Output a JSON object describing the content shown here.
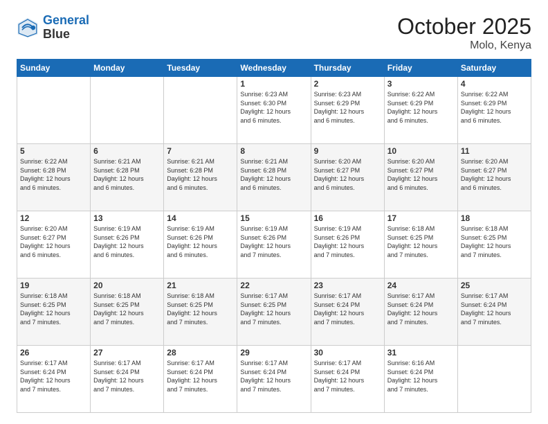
{
  "header": {
    "logo_line1": "General",
    "logo_line2": "Blue",
    "month": "October 2025",
    "location": "Molo, Kenya"
  },
  "weekdays": [
    "Sunday",
    "Monday",
    "Tuesday",
    "Wednesday",
    "Thursday",
    "Friday",
    "Saturday"
  ],
  "rows": [
    [
      {
        "day": "",
        "lines": []
      },
      {
        "day": "",
        "lines": []
      },
      {
        "day": "",
        "lines": []
      },
      {
        "day": "1",
        "lines": [
          "Sunrise: 6:23 AM",
          "Sunset: 6:30 PM",
          "Daylight: 12 hours",
          "and 6 minutes."
        ]
      },
      {
        "day": "2",
        "lines": [
          "Sunrise: 6:23 AM",
          "Sunset: 6:29 PM",
          "Daylight: 12 hours",
          "and 6 minutes."
        ]
      },
      {
        "day": "3",
        "lines": [
          "Sunrise: 6:22 AM",
          "Sunset: 6:29 PM",
          "Daylight: 12 hours",
          "and 6 minutes."
        ]
      },
      {
        "day": "4",
        "lines": [
          "Sunrise: 6:22 AM",
          "Sunset: 6:29 PM",
          "Daylight: 12 hours",
          "and 6 minutes."
        ]
      }
    ],
    [
      {
        "day": "5",
        "lines": [
          "Sunrise: 6:22 AM",
          "Sunset: 6:28 PM",
          "Daylight: 12 hours",
          "and 6 minutes."
        ]
      },
      {
        "day": "6",
        "lines": [
          "Sunrise: 6:21 AM",
          "Sunset: 6:28 PM",
          "Daylight: 12 hours",
          "and 6 minutes."
        ]
      },
      {
        "day": "7",
        "lines": [
          "Sunrise: 6:21 AM",
          "Sunset: 6:28 PM",
          "Daylight: 12 hours",
          "and 6 minutes."
        ]
      },
      {
        "day": "8",
        "lines": [
          "Sunrise: 6:21 AM",
          "Sunset: 6:28 PM",
          "Daylight: 12 hours",
          "and 6 minutes."
        ]
      },
      {
        "day": "9",
        "lines": [
          "Sunrise: 6:20 AM",
          "Sunset: 6:27 PM",
          "Daylight: 12 hours",
          "and 6 minutes."
        ]
      },
      {
        "day": "10",
        "lines": [
          "Sunrise: 6:20 AM",
          "Sunset: 6:27 PM",
          "Daylight: 12 hours",
          "and 6 minutes."
        ]
      },
      {
        "day": "11",
        "lines": [
          "Sunrise: 6:20 AM",
          "Sunset: 6:27 PM",
          "Daylight: 12 hours",
          "and 6 minutes."
        ]
      }
    ],
    [
      {
        "day": "12",
        "lines": [
          "Sunrise: 6:20 AM",
          "Sunset: 6:27 PM",
          "Daylight: 12 hours",
          "and 6 minutes."
        ]
      },
      {
        "day": "13",
        "lines": [
          "Sunrise: 6:19 AM",
          "Sunset: 6:26 PM",
          "Daylight: 12 hours",
          "and 6 minutes."
        ]
      },
      {
        "day": "14",
        "lines": [
          "Sunrise: 6:19 AM",
          "Sunset: 6:26 PM",
          "Daylight: 12 hours",
          "and 6 minutes."
        ]
      },
      {
        "day": "15",
        "lines": [
          "Sunrise: 6:19 AM",
          "Sunset: 6:26 PM",
          "Daylight: 12 hours",
          "and 7 minutes."
        ]
      },
      {
        "day": "16",
        "lines": [
          "Sunrise: 6:19 AM",
          "Sunset: 6:26 PM",
          "Daylight: 12 hours",
          "and 7 minutes."
        ]
      },
      {
        "day": "17",
        "lines": [
          "Sunrise: 6:18 AM",
          "Sunset: 6:25 PM",
          "Daylight: 12 hours",
          "and 7 minutes."
        ]
      },
      {
        "day": "18",
        "lines": [
          "Sunrise: 6:18 AM",
          "Sunset: 6:25 PM",
          "Daylight: 12 hours",
          "and 7 minutes."
        ]
      }
    ],
    [
      {
        "day": "19",
        "lines": [
          "Sunrise: 6:18 AM",
          "Sunset: 6:25 PM",
          "Daylight: 12 hours",
          "and 7 minutes."
        ]
      },
      {
        "day": "20",
        "lines": [
          "Sunrise: 6:18 AM",
          "Sunset: 6:25 PM",
          "Daylight: 12 hours",
          "and 7 minutes."
        ]
      },
      {
        "day": "21",
        "lines": [
          "Sunrise: 6:18 AM",
          "Sunset: 6:25 PM",
          "Daylight: 12 hours",
          "and 7 minutes."
        ]
      },
      {
        "day": "22",
        "lines": [
          "Sunrise: 6:17 AM",
          "Sunset: 6:25 PM",
          "Daylight: 12 hours",
          "and 7 minutes."
        ]
      },
      {
        "day": "23",
        "lines": [
          "Sunrise: 6:17 AM",
          "Sunset: 6:24 PM",
          "Daylight: 12 hours",
          "and 7 minutes."
        ]
      },
      {
        "day": "24",
        "lines": [
          "Sunrise: 6:17 AM",
          "Sunset: 6:24 PM",
          "Daylight: 12 hours",
          "and 7 minutes."
        ]
      },
      {
        "day": "25",
        "lines": [
          "Sunrise: 6:17 AM",
          "Sunset: 6:24 PM",
          "Daylight: 12 hours",
          "and 7 minutes."
        ]
      }
    ],
    [
      {
        "day": "26",
        "lines": [
          "Sunrise: 6:17 AM",
          "Sunset: 6:24 PM",
          "Daylight: 12 hours",
          "and 7 minutes."
        ]
      },
      {
        "day": "27",
        "lines": [
          "Sunrise: 6:17 AM",
          "Sunset: 6:24 PM",
          "Daylight: 12 hours",
          "and 7 minutes."
        ]
      },
      {
        "day": "28",
        "lines": [
          "Sunrise: 6:17 AM",
          "Sunset: 6:24 PM",
          "Daylight: 12 hours",
          "and 7 minutes."
        ]
      },
      {
        "day": "29",
        "lines": [
          "Sunrise: 6:17 AM",
          "Sunset: 6:24 PM",
          "Daylight: 12 hours",
          "and 7 minutes."
        ]
      },
      {
        "day": "30",
        "lines": [
          "Sunrise: 6:17 AM",
          "Sunset: 6:24 PM",
          "Daylight: 12 hours",
          "and 7 minutes."
        ]
      },
      {
        "day": "31",
        "lines": [
          "Sunrise: 6:16 AM",
          "Sunset: 6:24 PM",
          "Daylight: 12 hours",
          "and 7 minutes."
        ]
      },
      {
        "day": "",
        "lines": []
      }
    ]
  ]
}
